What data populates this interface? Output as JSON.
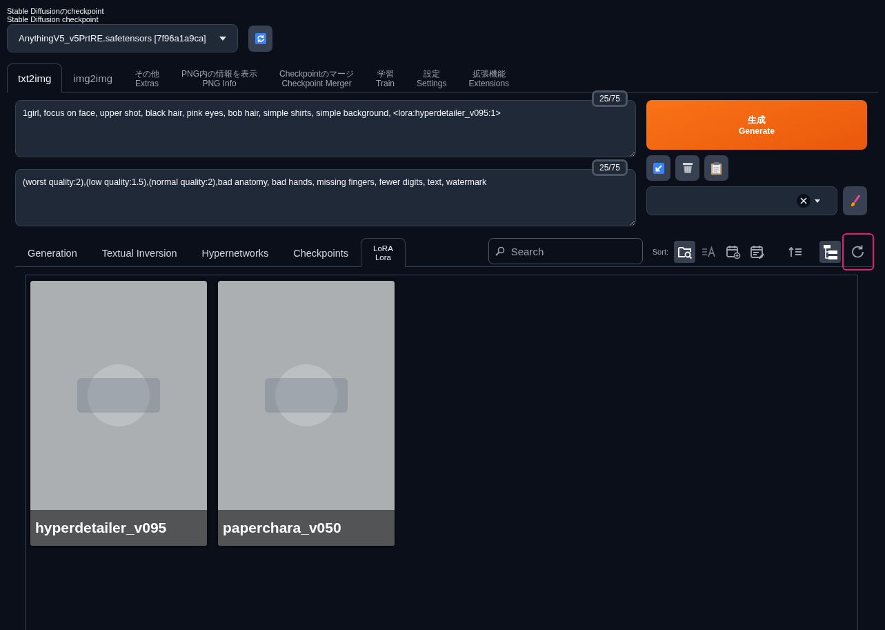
{
  "checkpoint": {
    "label_ja": "Stable Diffusionのcheckpoint",
    "label_en": "Stable Diffusion checkpoint",
    "value": "AnythingV5_v5PrtRE.safetensors [7f96a1a9ca]"
  },
  "main_tabs": [
    {
      "label": "txt2img",
      "selected": true
    },
    {
      "label": "img2img",
      "selected": false
    },
    {
      "label": "その他",
      "sublabel": "Extras",
      "selected": false
    },
    {
      "label": "PNG内の情報を表示",
      "sublabel": "PNG Info",
      "selected": false
    },
    {
      "label": "Checkpointのマージ",
      "sublabel": "Checkpoint Merger",
      "selected": false
    },
    {
      "label": "学習",
      "sublabel": "Train",
      "selected": false
    },
    {
      "label": "設定",
      "sublabel": "Settings",
      "selected": false
    },
    {
      "label": "拡張機能",
      "sublabel": "Extensions",
      "selected": false
    }
  ],
  "prompt": {
    "text": "1girl, focus on face, upper shot, black hair, pink eyes, bob hair, simple shirts, simple background, <lora:hyperdetailer_v095:1>",
    "token_count": "25/75"
  },
  "negative_prompt": {
    "text": "(worst quality:2),(low quality:1.5),(normal quality:2),bad anatomy, bad hands, missing fingers, fewer digits, text, watermark",
    "token_count": "25/75"
  },
  "generate_button": {
    "label": "生成",
    "sublabel": "Generate"
  },
  "extra_tabs": [
    {
      "label": "Generation",
      "selected": false
    },
    {
      "label": "Textual Inversion",
      "selected": false
    },
    {
      "label": "Hypernetworks",
      "selected": false
    },
    {
      "label": "Checkpoints",
      "selected": false
    },
    {
      "label": "LoRA",
      "sublabel": "Lora",
      "selected": true
    }
  ],
  "search": {
    "placeholder": "Search"
  },
  "sort_label": "Sort:",
  "toolbar": [
    {
      "kind": "sort-path",
      "selected": true,
      "highlighted": false
    },
    {
      "kind": "sort-name",
      "selected": false,
      "highlighted": false
    },
    {
      "kind": "sort-created",
      "selected": false,
      "highlighted": false
    },
    {
      "kind": "sort-modified",
      "selected": false,
      "highlighted": false
    },
    {
      "kind": "direction",
      "selected": false,
      "highlighted": false
    },
    {
      "kind": "tree-view",
      "selected": true,
      "highlighted": false
    },
    {
      "kind": "refresh",
      "selected": false,
      "highlighted": true
    }
  ],
  "cards": [
    {
      "name": "hyperdetailer_v095"
    },
    {
      "name": "paperchara_v050"
    }
  ]
}
